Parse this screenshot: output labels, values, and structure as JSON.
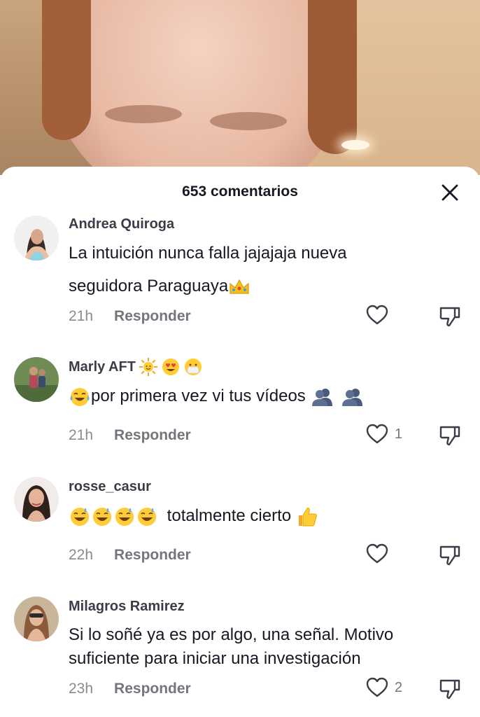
{
  "header": {
    "title": "653 comentarios"
  },
  "comments": [
    {
      "user": "Andrea Quiroga",
      "text": "La intuición nunca falla jajajaja nueva seguidora Paraguaya",
      "time": "21h",
      "reply_label": "Responder",
      "likes": ""
    },
    {
      "user": "Marly AFT",
      "text": "por primera vez vi tus vídeos",
      "time": "21h",
      "reply_label": "Responder",
      "likes": "1"
    },
    {
      "user": "rosse_casur",
      "text": "totalmente cierto",
      "time": "22h",
      "reply_label": "Responder",
      "likes": ""
    },
    {
      "user": "Milagros Ramirez",
      "text": "Si lo soñé ya es por algo, una señal. Motivo suficiente para iniciar una investigación",
      "time": "23h",
      "reply_label": "Responder",
      "likes": "2"
    }
  ],
  "colors": {
    "text": "#161823",
    "muted": "#8a8b91",
    "icon": "#3a3d47"
  },
  "icons": [
    "close-icon",
    "heart-icon",
    "dislike-icon",
    "crown-emoji",
    "sun-emoji",
    "heart-eyes-emoji",
    "face-with-mask-emoji",
    "tears-of-joy-emoji",
    "busts-emoji",
    "grinning-sweat-emoji",
    "thumbs-up-emoji"
  ]
}
